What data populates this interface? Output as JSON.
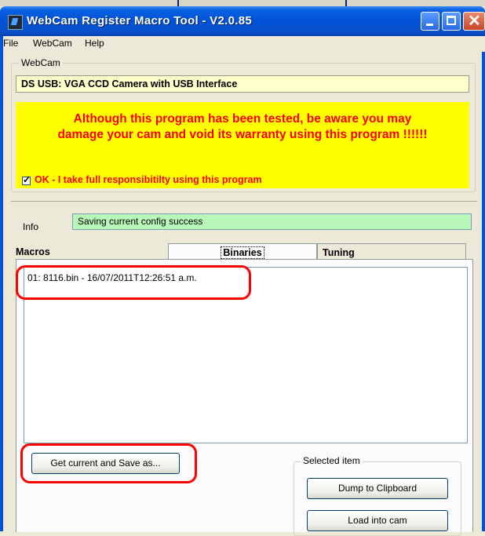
{
  "window": {
    "title": "WebCam Register Macro Tool - V2.0.85"
  },
  "menu": {
    "items": [
      {
        "label": "File"
      },
      {
        "label": "WebCam"
      },
      {
        "label": "Help"
      }
    ]
  },
  "webcam": {
    "group_label": "WebCam",
    "camera_name": "DS USB: VGA CCD Camera with USB Interface",
    "warning_line1": "Although this program has been tested, be aware you may",
    "warning_line2": "damage your cam and void its warranty using this program !!!!!!",
    "checkbox_label": "OK - I take full responsibitilty using this program",
    "checkbox_checked": true
  },
  "info": {
    "label": "Info",
    "value": "Saving current config success"
  },
  "tabs": [
    {
      "label": "Macros",
      "active": false
    },
    {
      "label": "Binaries",
      "active": true
    },
    {
      "label": "Tuning",
      "active": false
    }
  ],
  "binaries": {
    "items": [
      "01: 8116.bin - 16/07/2011T12:26:51 a.m."
    ],
    "save_as_label": "Get current and Save as..."
  },
  "selected_item": {
    "group_label": "Selected item",
    "dump_label": "Dump to Clipboard",
    "load_label": "Load into cam"
  },
  "colors": {
    "title_bar": "#0052d6",
    "warning_background": "#ffff00",
    "warning_text": "#ff0000",
    "info_background": "#b8f7b8",
    "camera_field_background": "#ffffcc",
    "annotation": "#ff0000"
  },
  "icons": {
    "app": "webcam-app-icon",
    "minimize": "minimize-icon",
    "maximize": "maximize-icon",
    "close": "close-icon",
    "check": "checkmark-icon"
  }
}
